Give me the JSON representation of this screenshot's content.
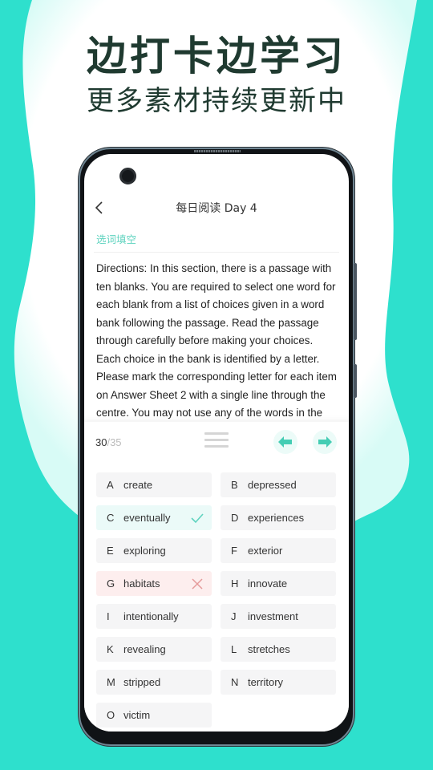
{
  "promo": {
    "headline": "边打卡边学习",
    "subheadline": "更多素材持续更新中"
  },
  "app": {
    "title": "每日阅读 Day 4",
    "section_label": "选词填空",
    "passage": "Directions: In this section, there is a passage with ten blanks. You are required to select one word for each blank from a list of choices given in a word bank following the passage. Read the passage through carefully before making your choices. Each choice in the bank is identified by a letter. Please mark the corresponding letter for each item on Answer Sheet 2 with a single line through the centre. You may not use any of the words in the",
    "progress": {
      "current": "30",
      "total": "/35"
    },
    "icons": {
      "back": "chevron-left-icon",
      "menu": "menu-icon",
      "prev": "arrow-left-icon",
      "next": "arrow-right-icon",
      "correct": "check-icon",
      "wrong": "cross-icon"
    },
    "colors": {
      "accent": "#5fd3bf",
      "correct_bg": "#ebfaf8",
      "wrong_bg": "#fdeeee",
      "wrong_mark": "#e59a9a",
      "background": "#2ee0cd"
    },
    "options": [
      {
        "letter": "A",
        "word": "create",
        "state": "none"
      },
      {
        "letter": "B",
        "word": "depressed",
        "state": "none"
      },
      {
        "letter": "C",
        "word": "eventually",
        "state": "correct"
      },
      {
        "letter": "D",
        "word": "experiences",
        "state": "none"
      },
      {
        "letter": "E",
        "word": "exploring",
        "state": "none"
      },
      {
        "letter": "F",
        "word": "exterior",
        "state": "none"
      },
      {
        "letter": "G",
        "word": "habitats",
        "state": "wrong"
      },
      {
        "letter": "H",
        "word": "innovate",
        "state": "none"
      },
      {
        "letter": "I",
        "word": "intentionally",
        "state": "none"
      },
      {
        "letter": "J",
        "word": "investment",
        "state": "none"
      },
      {
        "letter": "K",
        "word": "revealing",
        "state": "none"
      },
      {
        "letter": "L",
        "word": "stretches",
        "state": "none"
      },
      {
        "letter": "M",
        "word": "stripped",
        "state": "none"
      },
      {
        "letter": "N",
        "word": "territory",
        "state": "none"
      },
      {
        "letter": "O",
        "word": "victim",
        "state": "none"
      }
    ]
  }
}
